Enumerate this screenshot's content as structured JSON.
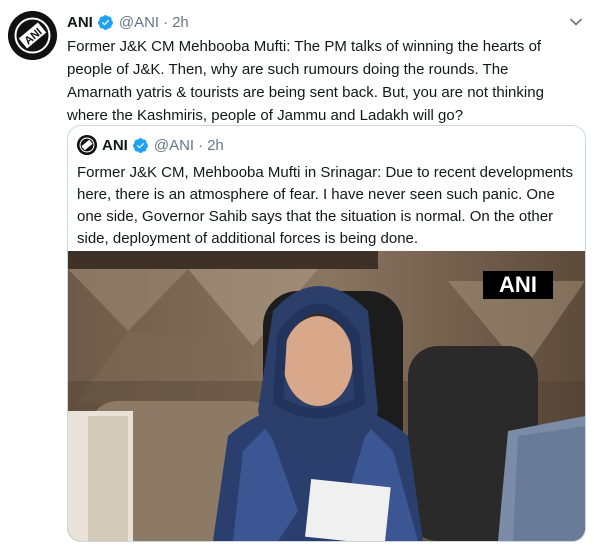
{
  "tweet": {
    "author": {
      "name": "ANI",
      "handle": "@ANI",
      "time": "2h"
    },
    "text": "Former J&K CM Mehbooba Mufti: The PM talks of winning the hearts of people of J&K. Then, why are such rumours doing the rounds. The Amarnath yatris & tourists are being sent back. But, you are not thinking where the Kashmiris, people of Jammu and Ladakh will go?",
    "separator": "·",
    "avatar_icon": "ani-logo-icon",
    "verified_icon": "verified-badge-icon",
    "menu_icon": "chevron-down-icon"
  },
  "quoted": {
    "author": {
      "name": "ANI",
      "handle": "@ANI",
      "time": "2h"
    },
    "text": "Former J&K CM, Mehbooba Mufti in Srinagar: Due to recent developments here, there is an atmosphere of fear. I have never seen such panic. One one side, Governor Sahib says that the situation is normal. On the other side, deployment of additional forces is being done.",
    "separator": "·",
    "media": {
      "watermark": "ANI",
      "kind": "photo"
    }
  },
  "colors": {
    "verified": "#1da1f2",
    "secondary_text": "#657786",
    "border": "#ccd6dd"
  }
}
